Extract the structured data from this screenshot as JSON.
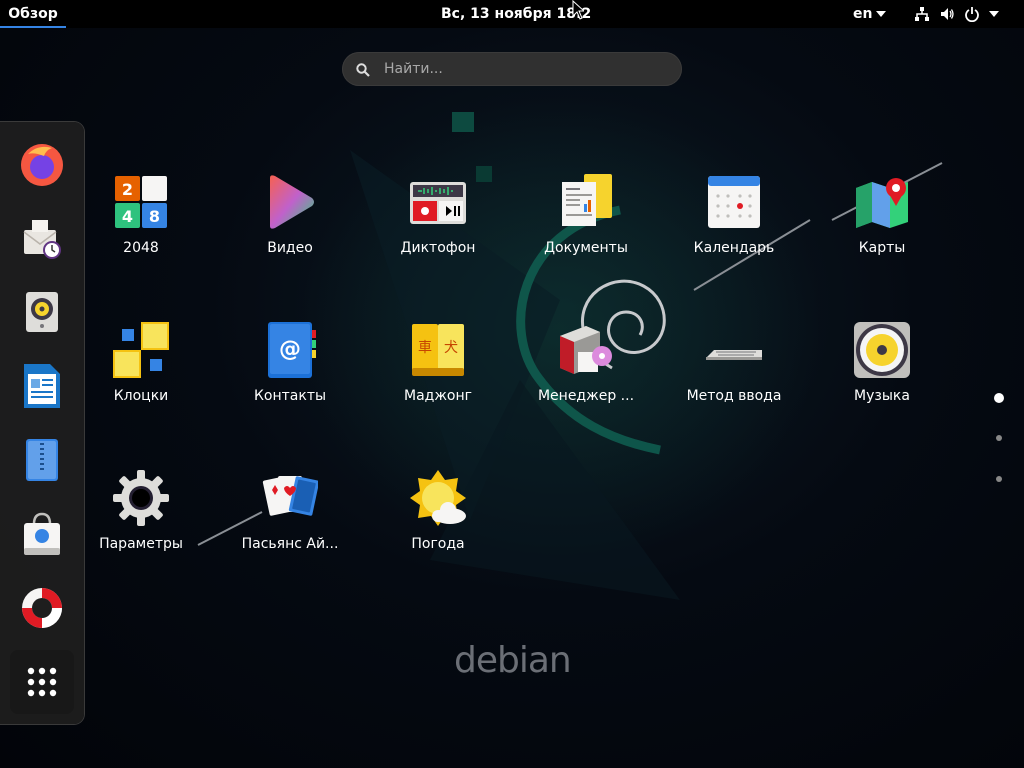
{
  "topbar": {
    "activities": "Обзор",
    "clock": "Вс, 13 ноября  18:2",
    "language": "en"
  },
  "search": {
    "placeholder": "Найти..."
  },
  "background": {
    "logo_text": "debian"
  },
  "dash": {
    "items": [
      {
        "name": "firefox"
      },
      {
        "name": "evolution"
      },
      {
        "name": "rhythmbox"
      },
      {
        "name": "libreoffice-writer"
      },
      {
        "name": "file-archive"
      },
      {
        "name": "software"
      },
      {
        "name": "help"
      }
    ],
    "show_apps": "show-applications"
  },
  "apps": [
    {
      "label": "2048"
    },
    {
      "label": "Видео"
    },
    {
      "label": "Диктофон"
    },
    {
      "label": "Документы"
    },
    {
      "label": "Календарь"
    },
    {
      "label": "Карты"
    },
    {
      "label": "Клоцки"
    },
    {
      "label": "Контакты"
    },
    {
      "label": "Маджонг"
    },
    {
      "label": "Менеджер ..."
    },
    {
      "label": "Метод ввода"
    },
    {
      "label": "Музыка"
    },
    {
      "label": "Параметры"
    },
    {
      "label": "Пасьянс Ай..."
    },
    {
      "label": "Погода"
    }
  ],
  "pager": {
    "pages": 3,
    "current": 1
  },
  "colors": {
    "accent": "#3584e4",
    "debian_red": "#d70751",
    "teal": "#0f5c4f"
  }
}
